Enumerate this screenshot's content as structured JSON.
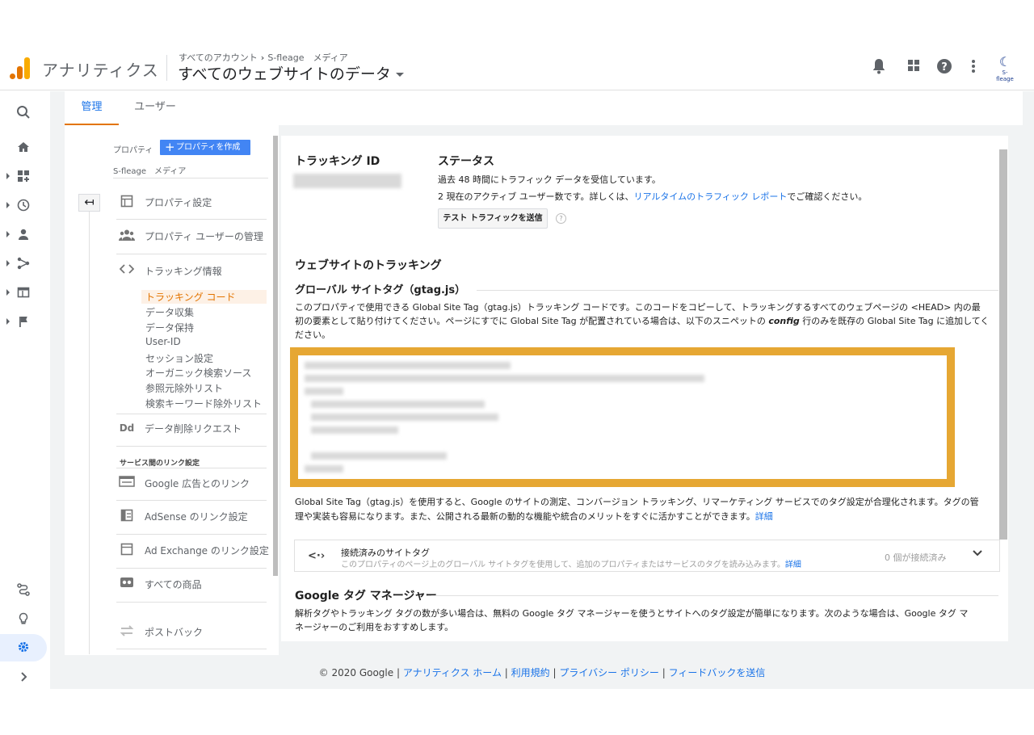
{
  "header": {
    "app_title": "アナリティクス",
    "breadcrumb_account": "すべてのアカウント",
    "breadcrumb_sep": "›",
    "breadcrumb_property": "S-fleage　メディア",
    "view_name": "すべてのウェブサイトのデータ",
    "icons": [
      "bell-icon",
      "apps-icon",
      "help-icon",
      "more-vert-icon"
    ],
    "brand_logo_text": "S-fleage"
  },
  "leftnav": {
    "icons": [
      "search-icon",
      "home-icon",
      "dashboard-icon",
      "clock-icon",
      "person-icon",
      "acquisition-icon",
      "behavior-icon",
      "flag-icon",
      "route-icon",
      "bulb-icon",
      "gear-icon",
      "expand-icon"
    ]
  },
  "tabs": [
    {
      "label": "管理",
      "active": true
    },
    {
      "label": "ユーザー",
      "active": false
    }
  ],
  "property_column": {
    "label": "プロパティ",
    "create_button": "プロパティを作成",
    "property_name": "S-fleage　メディア",
    "items": [
      {
        "label": "プロパティ設定",
        "icon": "property-settings-icon"
      },
      {
        "label": "プロパティ ユーザーの管理",
        "icon": "users-icon"
      },
      {
        "label": "トラッキング情報",
        "icon": "code-icon"
      }
    ],
    "tracking_sub_items": [
      "トラッキング コード",
      "データ収集",
      "データ保持",
      "User-ID",
      "セッション設定",
      "オーガニック検索ソース",
      "参照元除外リスト",
      "検索キーワード除外リスト"
    ],
    "data_deletion": "データ削除リクエスト",
    "link_section_title": "サービス間のリンク設定",
    "link_items": [
      "Google 広告とのリンク",
      "AdSense のリンク設定",
      "Ad Exchange のリンク設定",
      "すべての商品",
      "ポストバック"
    ]
  },
  "main": {
    "tracking_id_label": "トラッキング ID",
    "status_label": "ステータス",
    "status_line1": "過去 48 時間にトラフィック データを受信しています。",
    "status_line2_prefix": "2 現在のアクティブ ユーザー数です。詳しくは、",
    "status_line2_link": "リアルタイムのトラフィック レポート",
    "status_line2_suffix": "でご確認ください。",
    "test_button": "テスト トラフィックを送信",
    "help_mark": "?",
    "website_tracking_title": "ウェブサイトのトラッキング",
    "gtag_title": "グローバル サイトタグ（gtag.js）",
    "gtag_desc_line1": "このプロパティで使用できる Global Site Tag（gtag.js）トラッキング コードです。このコードをコピーして、トラッキングするすべてのウェブページの <HEAD> 内の最",
    "gtag_desc_line2_prefix": "初の要素として貼り付けてください。ページにすでに Global Site Tag が配置されている場合は、以下のスニペットの ",
    "gtag_desc_line2_config": "config",
    "gtag_desc_line2_suffix": " 行のみを既存の Global Site Tag に追加してく",
    "gtag_desc_line3": "ださい。",
    "gtag_info_line1": "Global Site Tag（gtag.js）を使用すると、Google のサイトの測定、コンバージョン トラッキング、リマーケティング サービスでのタグ設定が合理化されます。タグの管",
    "gtag_info_line2_prefix": "理や実装も容易になります。また、公開される最新の動的な機能や統合のメリットをすぐに活かすことができます。",
    "gtag_info_link": "詳細",
    "connected_title": "接続済みのサイトタグ",
    "connected_desc": "このプロパティのページ上のグローバル サイトタグを使用して、追加のプロパティまたはサービスのタグを読み込みます。",
    "connected_link": "詳細",
    "connected_count": "0 個が接続済み",
    "gtm_title": "Google タグ マネージャー",
    "gtm_desc_line1": "解析タグやトラッキング タグの数が多い場合は、無料の Google タグ マネージャーを使うとサイトへのタグ設定が簡単になります。次のような場合は、Google タグ マ",
    "gtm_desc_line2": "ネージャーのご利用をおすすめします。"
  },
  "footer": {
    "copyright": "© 2020 Google",
    "links": [
      "アナリティクス ホーム",
      "利用規約",
      "プライバシー ポリシー",
      "フィードバックを送信"
    ],
    "sep": " | "
  },
  "colors": {
    "accent_blue": "#1a73e8",
    "accent_orange": "#e37400",
    "code_border": "#e6a733"
  }
}
